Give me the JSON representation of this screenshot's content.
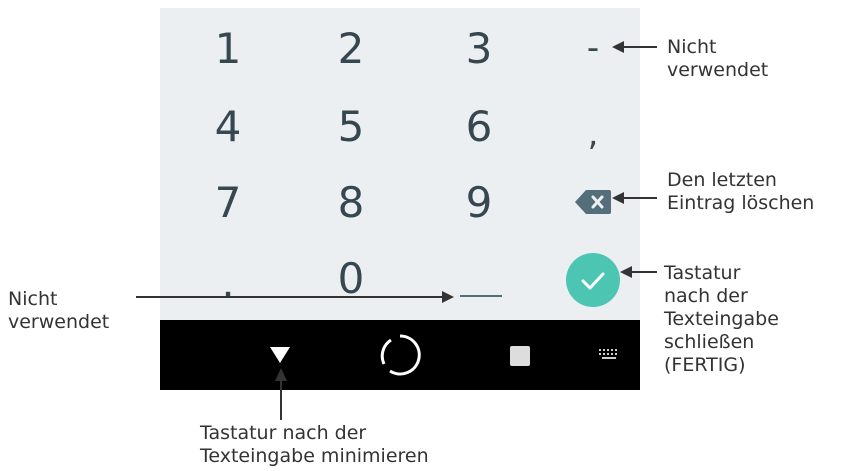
{
  "keypad": {
    "rows": [
      [
        "1",
        "2",
        "3",
        "-"
      ],
      [
        "4",
        "5",
        "6",
        ","
      ],
      [
        "7",
        "8",
        "9"
      ],
      [
        ".",
        "0",
        "_"
      ]
    ],
    "backspace_icon": "backspace-icon",
    "done_icon": "checkmark-icon",
    "done_color": "#4dc5b3"
  },
  "navbar": {
    "back_icon": "triangle-down-icon",
    "home_icon": "circle-icon",
    "recents_icon": "square-icon",
    "keyboard_icon": "keyboard-icon"
  },
  "callouts": {
    "minus_unused": [
      "Nicht",
      "verwendet"
    ],
    "delete_last": [
      "Den letzten",
      "Eintrag löschen"
    ],
    "close_keyboard": [
      "Tastatur",
      "nach der",
      "Texteingabe",
      "schließen",
      "(FERTIG)"
    ],
    "space_unused": [
      "Nicht",
      "verwendet"
    ],
    "minimize_keyboard": [
      "Tastatur nach der",
      "Texteingabe minimieren"
    ]
  },
  "colors": {
    "keypad_bg": "#eceff1",
    "key_text": "#37474f",
    "navbar_bg": "#000000",
    "callout_text": "#333333"
  }
}
